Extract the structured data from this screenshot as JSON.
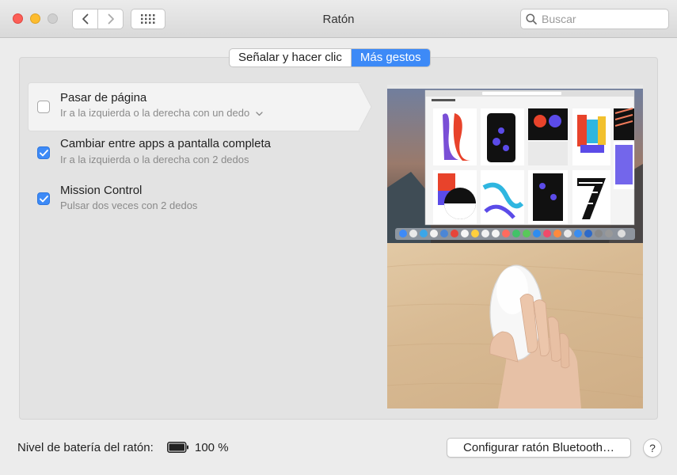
{
  "window": {
    "title": "Ratón"
  },
  "search": {
    "placeholder": "Buscar"
  },
  "tabs": [
    {
      "label": "Señalar y hacer clic",
      "active": false
    },
    {
      "label": "Más gestos",
      "active": true
    }
  ],
  "gestures": [
    {
      "title": "Pasar de página",
      "subtitle": "Ir a la izquierda o la derecha con un dedo",
      "checked": false,
      "has_dropdown": true,
      "selected": true
    },
    {
      "title": "Cambiar entre apps a pantalla completa",
      "subtitle": "Ir a la izquierda o la derecha con 2 dedos",
      "checked": true,
      "has_dropdown": false,
      "selected": false
    },
    {
      "title": "Mission Control",
      "subtitle": "Pulsar dos veces con 2 dedos",
      "checked": true,
      "has_dropdown": false,
      "selected": false
    }
  ],
  "footer": {
    "battery_label": "Nivel de batería del ratón:",
    "battery_value": "100 %",
    "battery_level": 1.0,
    "bluetooth_button": "Configurar ratón Bluetooth…",
    "help_label": "?"
  },
  "colors": {
    "accent": "#3d8af7",
    "close": "#fc5f57",
    "minimize": "#fdbc2e",
    "zoom_disabled": "#cfcfcf"
  },
  "icons": {
    "back": "chevron-left-icon",
    "forward": "chevron-right-icon",
    "grid": "grid-icon",
    "search": "magnifier-icon",
    "battery": "battery-full-icon",
    "checkmark": "checkmark-icon",
    "dropdown": "chevron-down-icon"
  }
}
